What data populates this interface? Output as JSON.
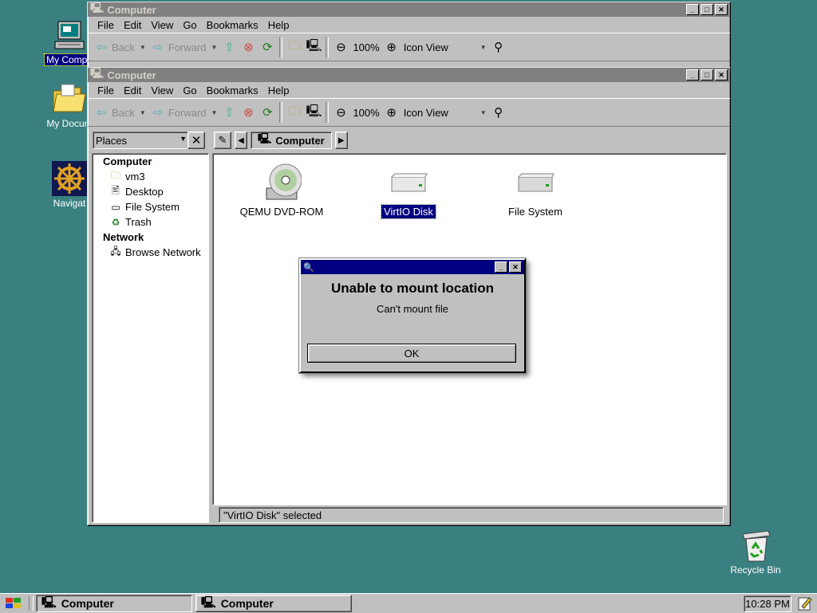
{
  "desktop": {
    "icons": [
      {
        "label": "My Compu",
        "icon": "computer-icon"
      },
      {
        "label": "My Docum",
        "icon": "folder-icon"
      },
      {
        "label": "Navigat",
        "icon": "ship-wheel-icon"
      },
      {
        "label": "Recycle Bin",
        "icon": "recycle-bin-icon"
      }
    ]
  },
  "window_back": {
    "title": "Computer",
    "menu": [
      "File",
      "Edit",
      "View",
      "Go",
      "Bookmarks",
      "Help"
    ],
    "toolbar": {
      "back": "Back",
      "forward": "Forward",
      "zoom": "100%",
      "view": "Icon View"
    }
  },
  "window_front": {
    "title": "Computer",
    "menu": [
      "File",
      "Edit",
      "View",
      "Go",
      "Bookmarks",
      "Help"
    ],
    "toolbar": {
      "back": "Back",
      "forward": "Forward",
      "zoom": "100%",
      "view": "Icon View"
    },
    "places": {
      "selected": "Places",
      "sections": [
        {
          "heading": "Computer",
          "items": [
            "vm3",
            "Desktop",
            "File System",
            "Trash"
          ]
        },
        {
          "heading": "Network",
          "items": [
            "Browse Network"
          ]
        }
      ]
    },
    "path": {
      "current": "Computer"
    },
    "files": [
      {
        "label": "QEMU DVD-ROM",
        "icon": "cdrom-icon"
      },
      {
        "label": "VirtIO Disk",
        "icon": "harddisk-icon",
        "selected": true
      },
      {
        "label": "File System",
        "icon": "harddisk-icon"
      }
    ],
    "status": "\"VirtIO Disk\" selected"
  },
  "dialog": {
    "title": "Unable to mount location",
    "message": "Can't mount file",
    "ok": "OK"
  },
  "taskbar": {
    "tasks": [
      "Computer",
      "Computer"
    ],
    "clock": "10:28 PM"
  },
  "colors": {
    "desktop": "#3a8080",
    "selection": "#000080",
    "face": "#c0c0c0"
  }
}
